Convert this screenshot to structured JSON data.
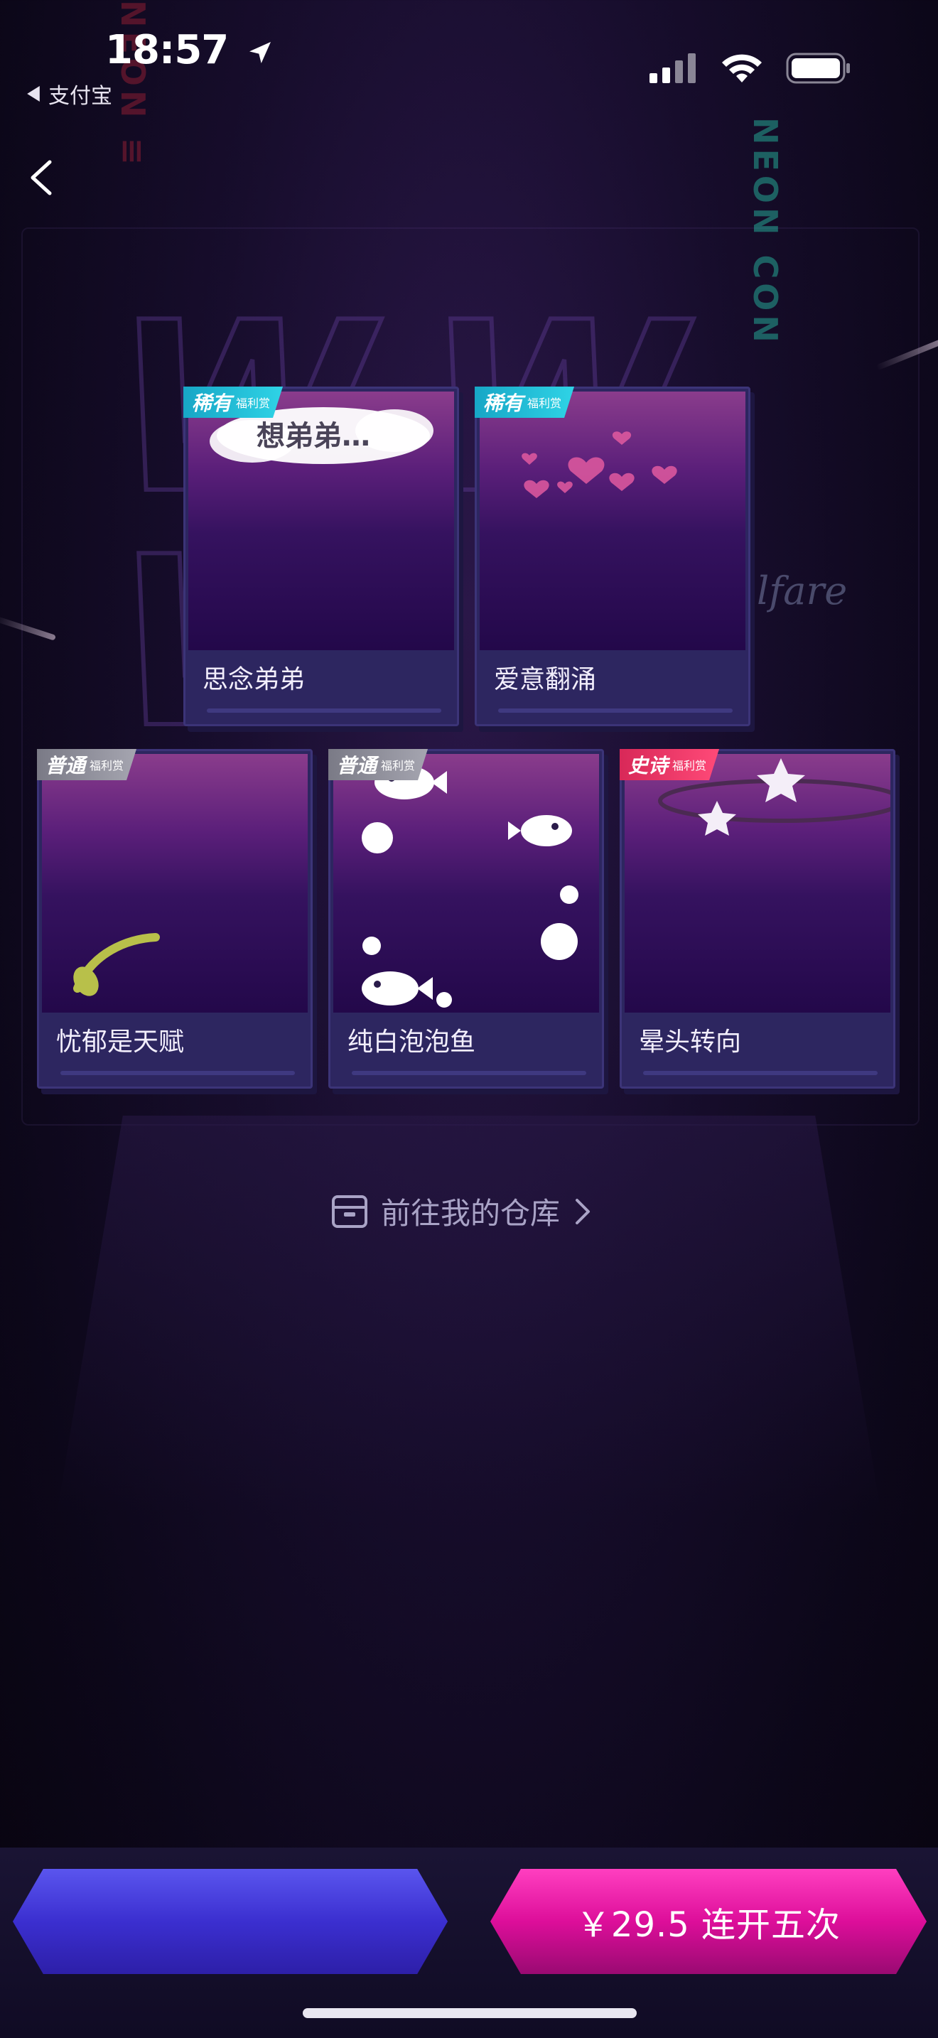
{
  "status_bar": {
    "time": "18:57",
    "back_app": "支付宝"
  },
  "icons": {
    "location": "location-arrow-icon",
    "signal": "cellular-signal-icon",
    "wifi": "wifi-icon",
    "battery": "battery-icon",
    "back": "chevron-left-icon",
    "warehouse": "box-icon",
    "chevron": "chevron-right-icon"
  },
  "cards": [
    {
      "label": "思念弟弟",
      "tier": "稀有",
      "badge_sub": "福利赏",
      "art_text": "想弟弟…"
    },
    {
      "label": "爱意翻涌",
      "tier": "稀有",
      "badge_sub": "福利赏"
    },
    {
      "label": "忧郁是天赋",
      "tier": "普通",
      "badge_sub": "福利赏"
    },
    {
      "label": "纯白泡泡鱼",
      "tier": "普通",
      "badge_sub": "福利赏"
    },
    {
      "label": "晕头转向",
      "tier": "史诗",
      "badge_sub": "福利赏"
    }
  ],
  "warehouse_link": "前往我的仓库",
  "buttons": {
    "left": "",
    "right": "￥29.5 连开五次"
  },
  "colors": {
    "rare": "#17a6c6",
    "common": "#8d8d98",
    "epic": "#e53064",
    "primary_button": "#dd0e9a",
    "secondary_button": "#3b2fd0"
  }
}
